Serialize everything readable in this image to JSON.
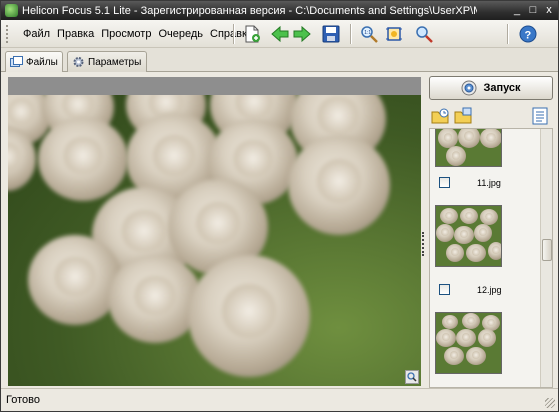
{
  "window": {
    "title": "Helicon Focus 5.1 Lite - Зарегистрированная версия - C:\\Documents and Settings\\UserXP\\Мои документы\\Мои рисунк...",
    "controls": [
      "_",
      "□",
      "x"
    ]
  },
  "menu": {
    "items": [
      "Файл",
      "Правка",
      "Просмотр",
      "Очередь",
      "Справка"
    ]
  },
  "toolbar": {
    "icons": [
      "new-document-icon",
      "back-arrow-icon",
      "forward-arrow-icon",
      "save-icon",
      "zoom-fit-icon",
      "crop-icon",
      "zoom-icon",
      "help-icon"
    ]
  },
  "tabs": [
    {
      "label": "Файлы",
      "active": true
    },
    {
      "label": "Параметры",
      "active": false
    }
  ],
  "side_panel": {
    "start_label": "Запуск",
    "files": [
      {
        "name": "11.jpg",
        "checked": false
      },
      {
        "name": "12.jpg",
        "checked": false
      }
    ]
  },
  "status": {
    "text": "Готово"
  }
}
